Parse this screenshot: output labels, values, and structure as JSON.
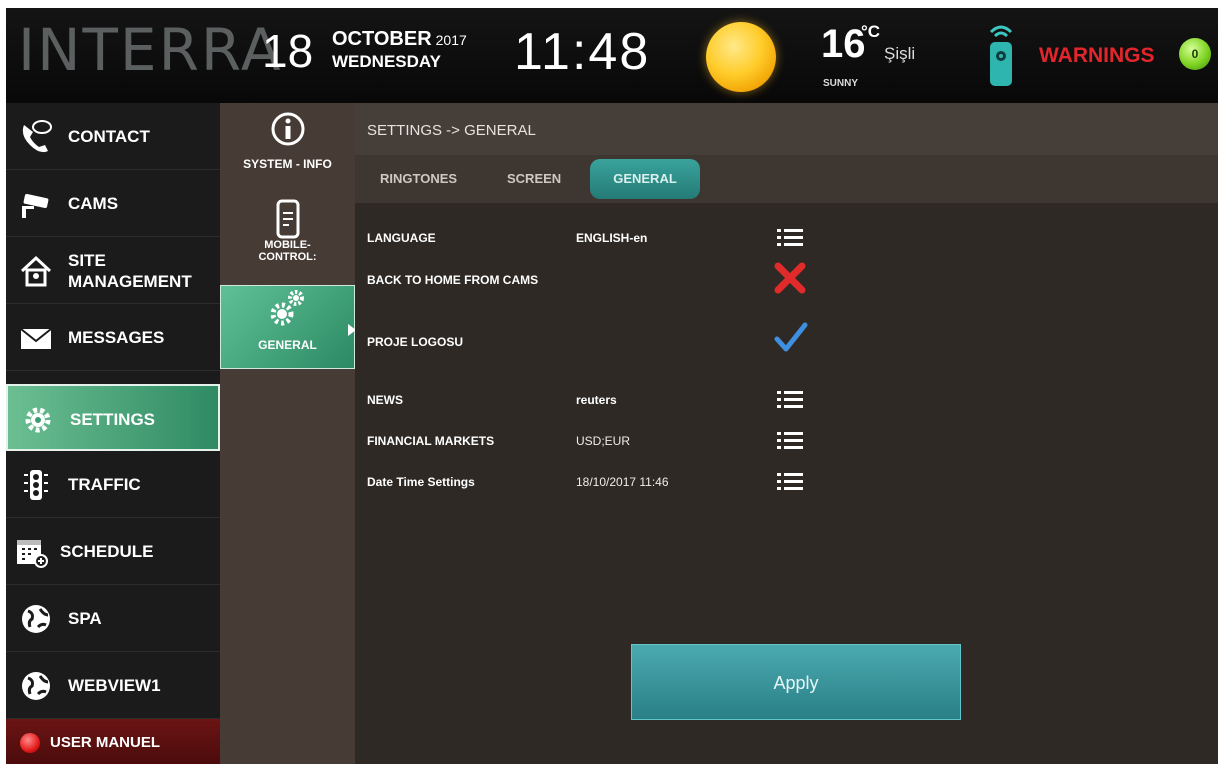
{
  "header": {
    "logo": "INTERRA",
    "day": "18",
    "month": "OCTOBER",
    "year": "2017",
    "weekday": "WEDNESDAY",
    "time": "11:48",
    "temperature": "16",
    "temp_unit": "°C",
    "city": "Şişli",
    "condition": "SUNNY",
    "warnings_label": "WARNINGS",
    "warnings_count": "0",
    "weather_icon": "sun-icon",
    "remote_icon": "remote-icon"
  },
  "nav": {
    "items": [
      {
        "label": "CONTACT",
        "icon": "phone-icon"
      },
      {
        "label": "CAMS",
        "icon": "camera-icon"
      },
      {
        "label": "SITE MANAGEMENT",
        "line1": "SITE",
        "line2": "MANAGEMENT",
        "icon": "home-icon"
      },
      {
        "label": "MESSAGES",
        "icon": "envelope-icon"
      },
      {
        "label": "SETTINGS",
        "icon": "gear-icon",
        "active": true
      },
      {
        "label": "TRAFFIC",
        "icon": "traffic-light-icon"
      },
      {
        "label": "SCHEDULE",
        "icon": "calendar-icon"
      },
      {
        "label": "SPA",
        "icon": "globe-icon"
      },
      {
        "label": "WEBVIEW1",
        "icon": "globe-icon"
      },
      {
        "label": "USER MANUEL",
        "icon": "red-dot-icon"
      }
    ]
  },
  "subnav": {
    "system_info": "SYSTEM - INFO",
    "mobile_line1": "MOBILE-",
    "mobile_line2": "CONTROL:",
    "general": "GENERAL"
  },
  "main": {
    "breadcrumb": "SETTINGS -> GENERAL",
    "tabs": [
      "RINGTONES",
      "SCREEN",
      "GENERAL"
    ],
    "active_tab": "GENERAL",
    "rows": [
      {
        "label": "LANGUAGE",
        "value": "ENGLISH-en",
        "control": "list-icon"
      },
      {
        "label": "BACK TO HOME FROM CAMS",
        "value": "",
        "control": "x-icon"
      },
      {
        "label": "PROJE LOGOSU",
        "value": "",
        "control": "check-icon"
      },
      {
        "label": "NEWS",
        "value": "reuters",
        "control": "list-icon"
      },
      {
        "label": "FINANCIAL MARKETS",
        "value": "USD;EUR",
        "control": "list-icon"
      },
      {
        "label": "Date Time Settings",
        "value": "18/10/2017 11:46",
        "control": "list-icon"
      }
    ],
    "apply_label": "Apply"
  },
  "colors": {
    "accent_teal": "#2f8f8c",
    "active_green": "#3e9c72",
    "warning_red": "#e3262b",
    "cross_red": "#e12b2b",
    "check_blue": "#3f8fe0"
  }
}
